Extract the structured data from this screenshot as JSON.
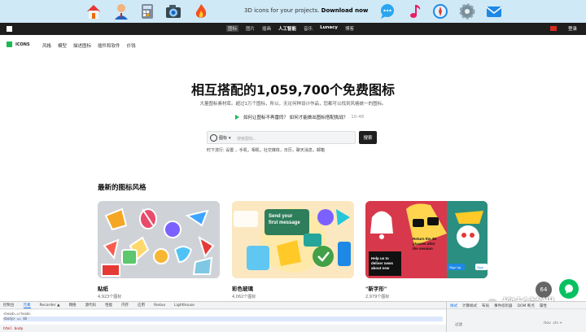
{
  "banner": {
    "message": "3D icons for your projects.",
    "cta": "Download now",
    "icons": [
      "house-3d-icon",
      "person-3d-icon",
      "calculator-3d-icon",
      "camera-3d-icon",
      "fire-3d-icon",
      "chat-bubble-3d-icon",
      "music-note-3d-icon",
      "compass-3d-icon",
      "gear-3d-icon",
      "mail-3d-icon"
    ]
  },
  "topnav": {
    "items": [
      "图标",
      "图片",
      "插画",
      "人工智能",
      "音乐",
      "Lunacy",
      "博客"
    ],
    "login": "登录"
  },
  "site": {
    "brand": "ICONS",
    "links": [
      "风格",
      "模型",
      "描述图标",
      "插件和软件",
      "价钱"
    ]
  },
  "hero": {
    "title": "相互搭配的1,059,700个免费图标",
    "subtitle": "大量图标素材库。超过1万个图标，所以，无论何种设计作品，您都可以找到风格统一的图标。",
    "tip": "如何让图标不再雷同？ 如何才能做出图标搭配挑战？",
    "tip_duration": "10:48"
  },
  "search": {
    "type_label": "图标",
    "placeholder": "搜索图标...",
    "button": "搜索",
    "trending": "时下流行: 设置 ，手机，相机，社交媒体，日历，聊天消息，邮箱"
  },
  "section": {
    "title": "最新的图标风格",
    "cards": [
      {
        "label": "贴纸",
        "count": "4,923个图标"
      },
      {
        "label": "彩色玻璃",
        "count": "4,062个图标"
      },
      {
        "label": "\"新字形\"",
        "count": "2,979个图标"
      }
    ],
    "card2_text": "Send your first message",
    "card3_text_a": "Return the 3D glasses after the session",
    "card3_text_b": "Help us to deliver news about new",
    "card3_signup": "Sign Up"
  },
  "overlay": {
    "badge": "64",
    "watermark": "柳杉前端"
  },
  "devtools": {
    "tabs": [
      "控制台",
      "元素",
      "Recorder ▲",
      "网络",
      "源代码",
      "性能",
      "内存",
      "应用",
      "Redux",
      "Lighthouse"
    ],
    "code_lines": [
      "<head>…</head>",
      "<body> == $0"
    ],
    "breadcrumbs": "html   body",
    "right_tabs": [
      "样式",
      "计算样式",
      "布局",
      "事件侦听器",
      "DOM 断点",
      "属性"
    ],
    "filter": "过滤",
    "hov": ":hov .cls +"
  }
}
